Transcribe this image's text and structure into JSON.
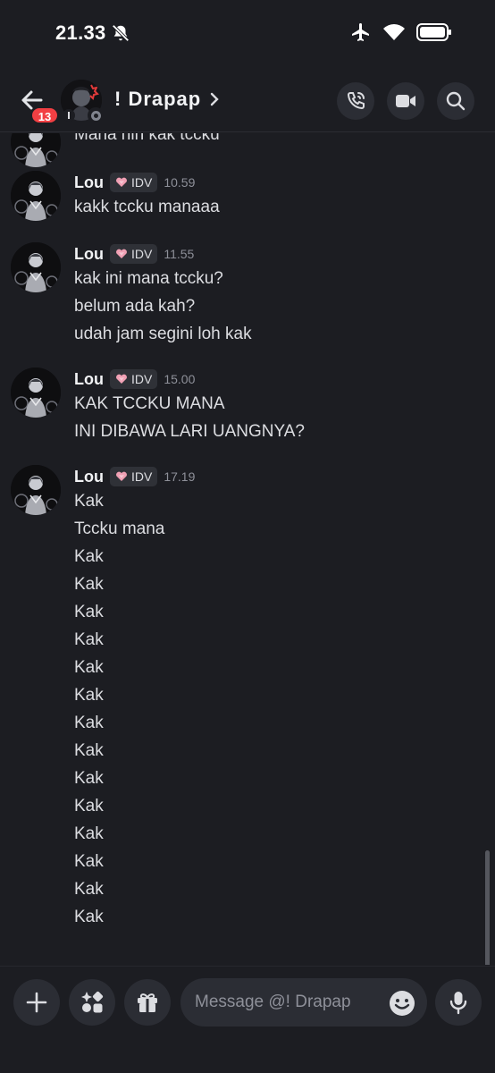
{
  "status_bar": {
    "time": "21.33"
  },
  "header": {
    "unread_badge": "13",
    "channel_name": "! Drapap"
  },
  "messages": {
    "cut_off_text": "Mana nih kak tccku",
    "groups": [
      {
        "author": "Lou",
        "tag": "IDV",
        "time": "10.59",
        "lines": [
          "kakk tccku manaaa"
        ]
      },
      {
        "author": "Lou",
        "tag": "IDV",
        "time": "11.55",
        "lines": [
          "kak ini mana tccku?",
          "belum ada kah?",
          "udah jam segini loh kak"
        ]
      },
      {
        "author": "Lou",
        "tag": "IDV",
        "time": "15.00",
        "lines": [
          "KAK TCCKU MANA",
          "INI DIBAWA LARI UANGNYA?"
        ]
      },
      {
        "author": "Lou",
        "tag": "IDV",
        "time": "17.19",
        "lines": [
          "Kak",
          "Tccku mana",
          "Kak",
          "Kak",
          "Kak",
          "Kak",
          "Kak",
          "Kak",
          "Kak",
          "Kak",
          "Kak",
          "Kak",
          "Kak",
          "Kak",
          "Kak",
          "Kak"
        ]
      }
    ]
  },
  "input": {
    "placeholder": "Message @! Drapap"
  },
  "icons": {
    "back": "arrow-left-icon",
    "call": "phone-call-icon",
    "video": "video-camera-icon",
    "search": "search-icon",
    "add": "plus-icon",
    "apps": "apps-sparkle-icon",
    "gift": "gift-icon",
    "emoji": "smiley-icon",
    "mic": "microphone-icon"
  },
  "colors": {
    "background": "#1c1d22",
    "badge": "#f23f43",
    "tag_heart": "#f0a0b4",
    "surface": "#2b2d34"
  }
}
